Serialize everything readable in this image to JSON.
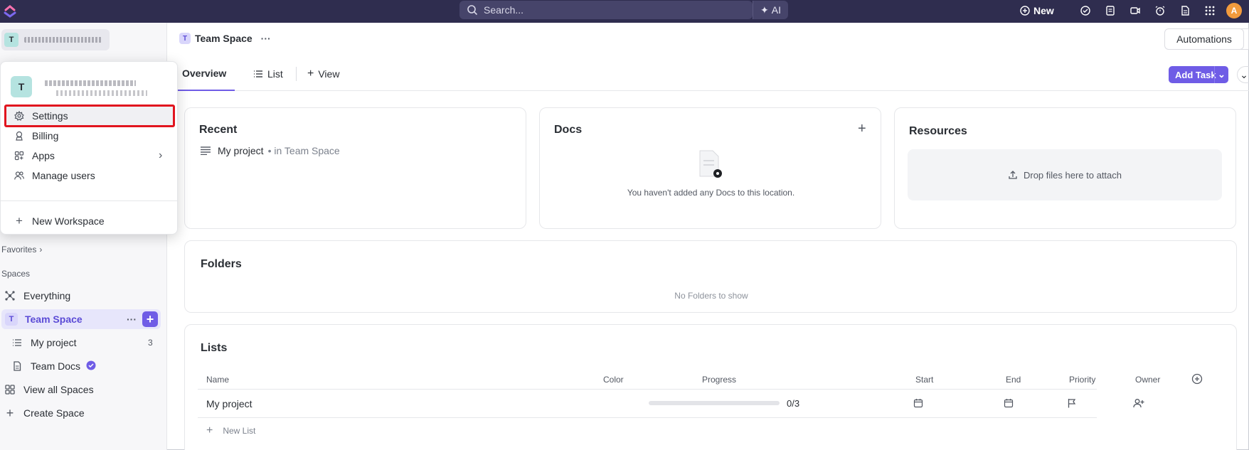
{
  "topbar": {
    "search_placeholder": "Search...",
    "ai_label": "AI",
    "new_label": "New",
    "avatar_initial": "A"
  },
  "sidebar": {
    "workspace_initial": "T",
    "favorites_label": "Favorites",
    "spaces_label": "Spaces",
    "items": {
      "everything": "Everything",
      "team_space": "Team Space",
      "team_space_initial": "T",
      "my_project": "My project",
      "my_project_count": "3",
      "team_docs": "Team Docs",
      "view_all_spaces": "View all Spaces",
      "create_space": "Create Space"
    }
  },
  "dropdown": {
    "workspace_initial": "T",
    "items": {
      "settings": "Settings",
      "billing": "Billing",
      "apps": "Apps",
      "manage_users": "Manage users",
      "new_workspace": "New Workspace"
    }
  },
  "header": {
    "space_initial": "T",
    "space_name": "Team Space",
    "more": "···",
    "automations": "Automations"
  },
  "tabs": {
    "overview": "Overview",
    "list": "List",
    "view": "View",
    "add_task": "Add Task"
  },
  "recent": {
    "title": "Recent",
    "item_name": "My project",
    "item_location": "• in Team Space"
  },
  "docs": {
    "title": "Docs",
    "empty_text": "You haven't added any Docs to this location."
  },
  "resources": {
    "title": "Resources",
    "drop_text": "Drop files here to attach"
  },
  "folders": {
    "title": "Folders",
    "empty_text": "No Folders to show"
  },
  "lists": {
    "title": "Lists",
    "columns": {
      "name": "Name",
      "color": "Color",
      "progress": "Progress",
      "start": "Start",
      "end": "End",
      "priority": "Priority",
      "owner": "Owner"
    },
    "rows": [
      {
        "name": "My project",
        "progress_text": "0/3",
        "progress_fraction": 0
      }
    ],
    "new_list": "New List"
  },
  "colors": {
    "accent": "#6f5ce6",
    "topbar": "#2f2d4f",
    "highlight_box": "#e1141e"
  }
}
